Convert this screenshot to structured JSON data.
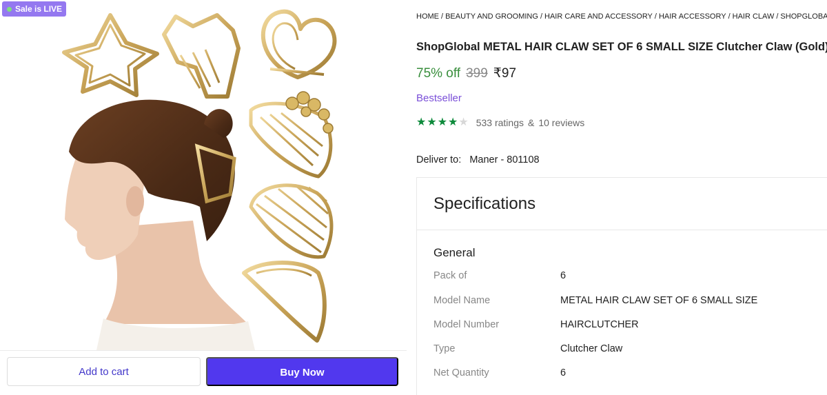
{
  "badge": {
    "label": "Sale is LIVE"
  },
  "product_image": {
    "alt": "hair-claw-product-photo"
  },
  "actions": {
    "add_to_cart": "Add to cart",
    "buy_now": "Buy Now"
  },
  "breadcrumb": [
    "HOME",
    "BEAUTY AND GROOMING",
    "HAIR CARE AND ACCESSORY",
    "HAIR ACCESSORY",
    "HAIR CLAW",
    "SHOPGLOBAL HAIR CL"
  ],
  "product": {
    "title": "ShopGlobal METAL HAIR CLAW SET OF 6 SMALL SIZE Clutcher Claw (Gold)",
    "discount": "75% off",
    "mrp": "399",
    "price": "₹97",
    "tag": "Bestseller",
    "rating_stars": 4,
    "ratings_text": "533 ratings",
    "amp": "&",
    "reviews_text": "10 reviews"
  },
  "delivery": {
    "label": "Deliver to:",
    "location": "Maner - 801108"
  },
  "specifications": {
    "title": "Specifications",
    "group": "General",
    "rows": [
      {
        "key": "Pack of",
        "value": "6"
      },
      {
        "key": "Model Name",
        "value": "METAL HAIR CLAW SET OF 6 SMALL SIZE"
      },
      {
        "key": "Model Number",
        "value": "HAIRCLUTCHER"
      },
      {
        "key": "Type",
        "value": "Clutcher Claw"
      },
      {
        "key": "Net Quantity",
        "value": "6"
      }
    ]
  },
  "colors": {
    "badge": "#9478f0",
    "buy_button": "#5138ee",
    "discount": "#388e3c",
    "bestseller": "#7a4fd8",
    "star": "#0d8a3b",
    "gold": "#c9a458"
  }
}
